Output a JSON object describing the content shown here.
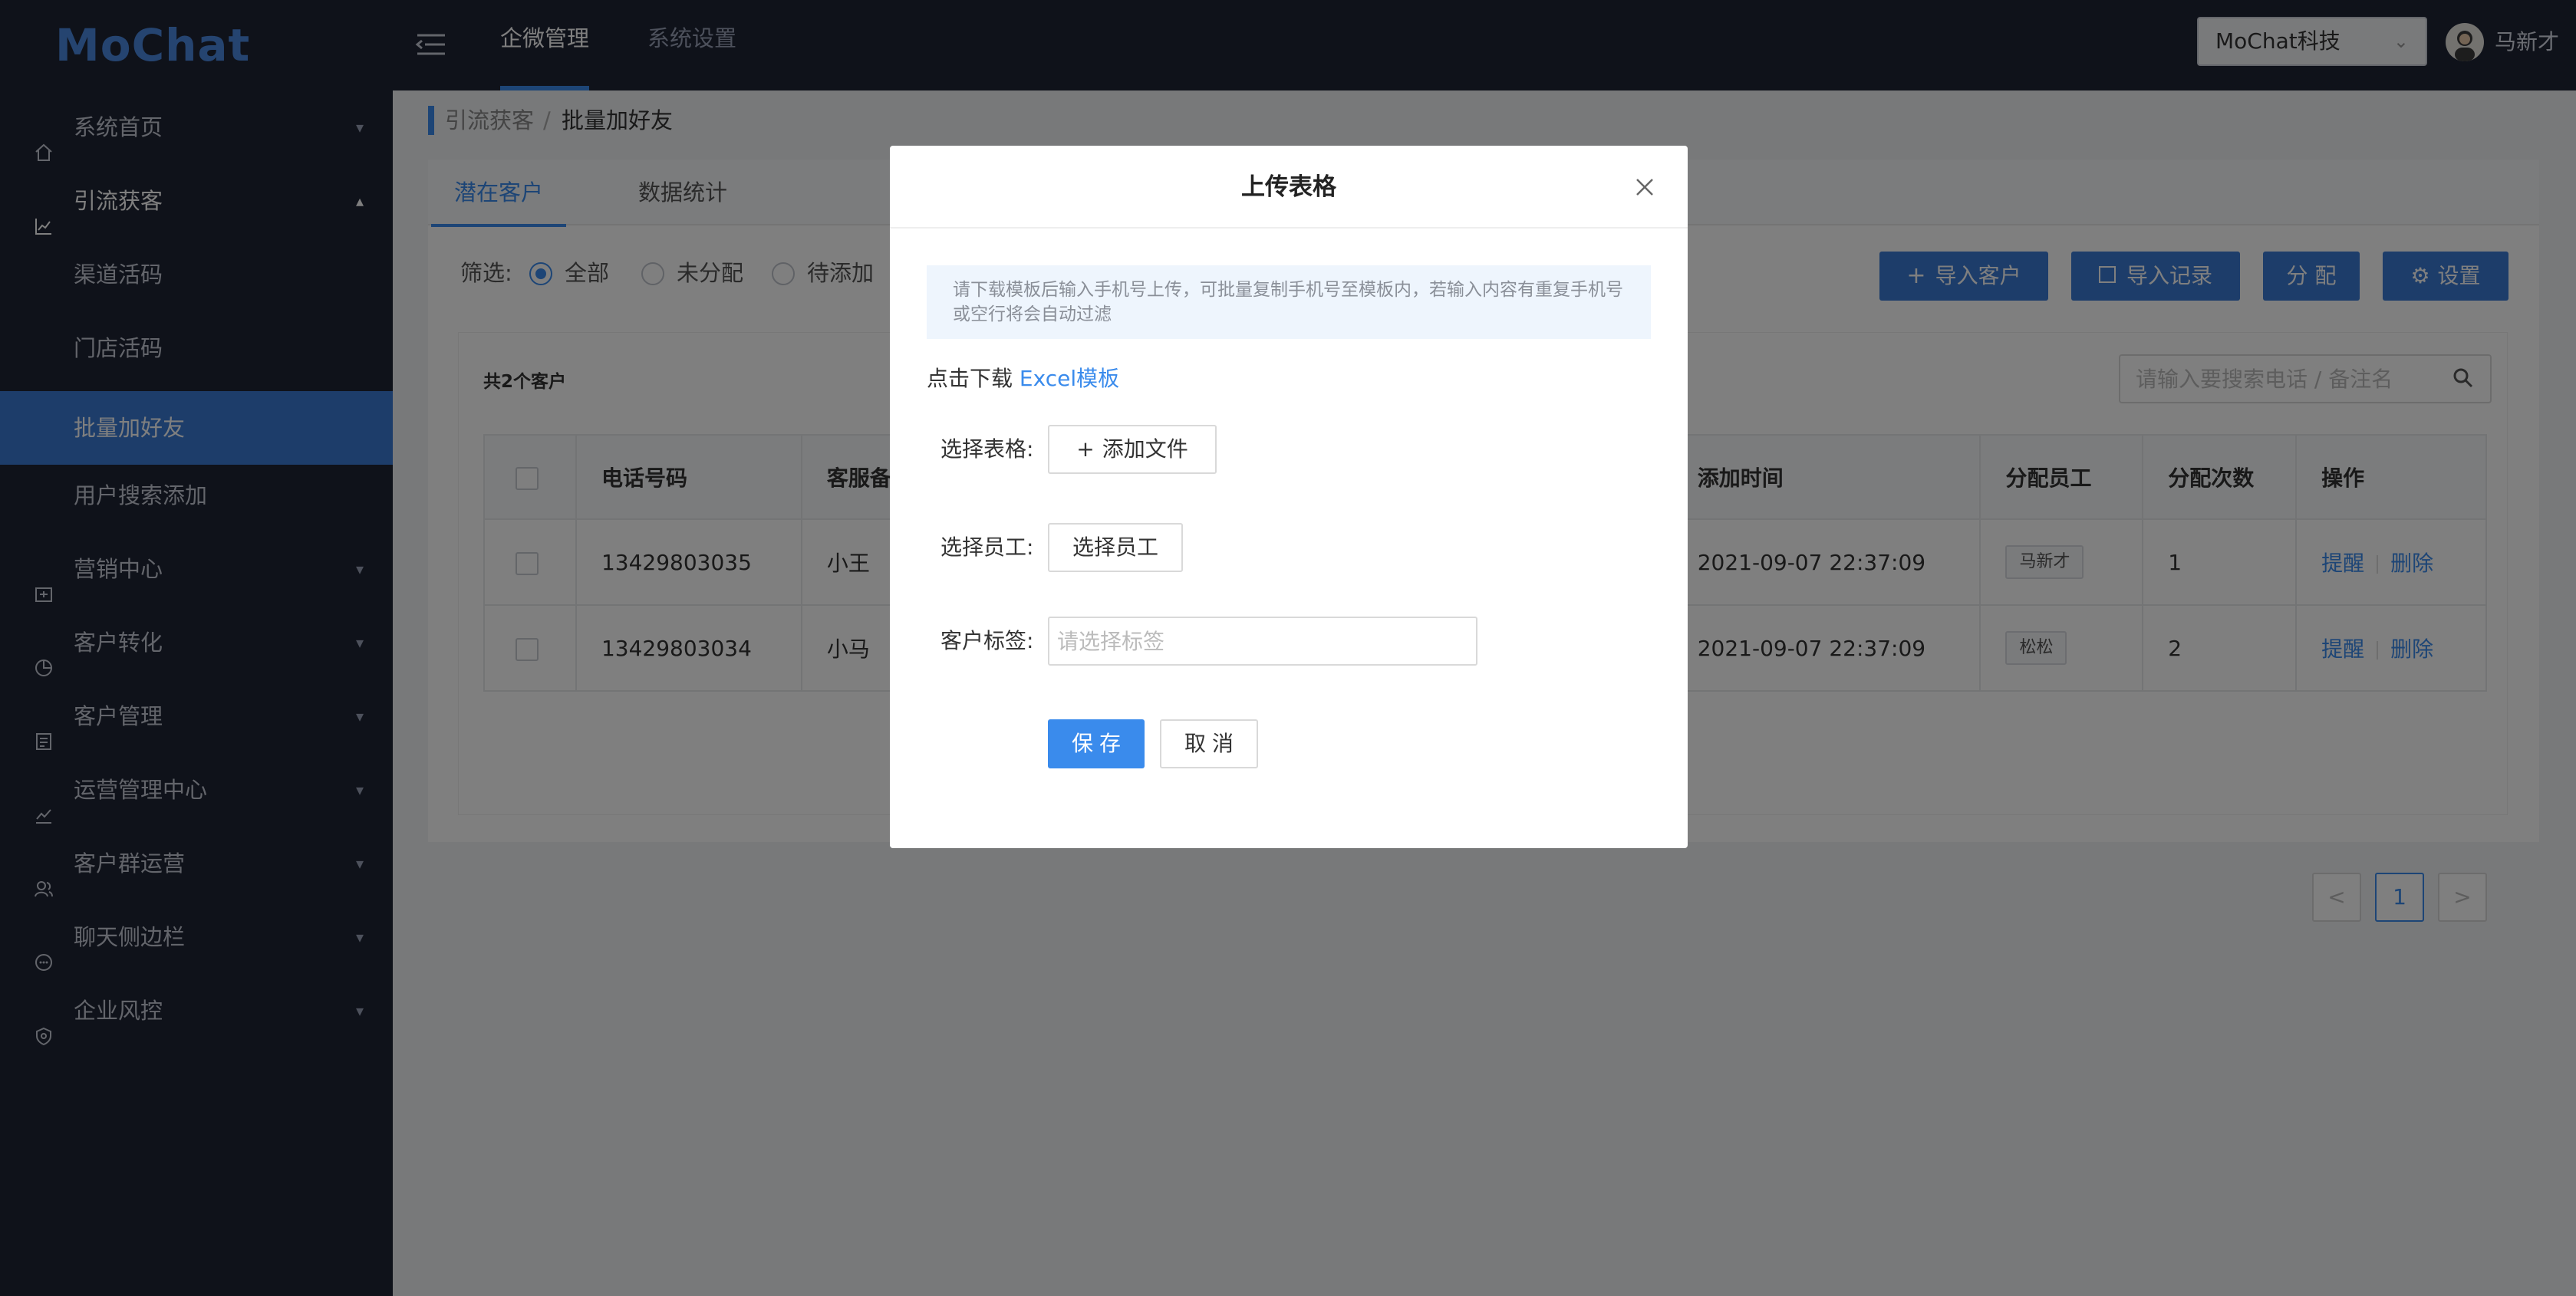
{
  "app": {
    "logo": "MoChat"
  },
  "top_nav": {
    "tabs": [
      {
        "label": "企微管理"
      },
      {
        "label": "系统设置"
      }
    ],
    "corp_select": "MoChat科技",
    "user_name": "马新才"
  },
  "sidebar": {
    "items": [
      {
        "label": "系统首页"
      },
      {
        "label": "引流获客"
      },
      {
        "label": "营销中心"
      },
      {
        "label": "客户转化"
      },
      {
        "label": "客户管理"
      },
      {
        "label": "运营管理中心"
      },
      {
        "label": "客户群运营"
      },
      {
        "label": "聊天侧边栏"
      },
      {
        "label": "企业风控"
      }
    ],
    "sub_items": [
      {
        "label": "渠道活码"
      },
      {
        "label": "门店活码"
      },
      {
        "label": "批量加好友"
      },
      {
        "label": "用户搜索添加"
      }
    ]
  },
  "breadcrumb": {
    "parent": "引流获客",
    "separator": "/",
    "current": "批量加好友"
  },
  "tabs": [
    {
      "label": "潜在客户"
    },
    {
      "label": "数据统计"
    }
  ],
  "filter": {
    "label": "筛选:",
    "options": [
      {
        "label": "全部"
      },
      {
        "label": "未分配"
      },
      {
        "label": "待添加"
      }
    ],
    "selected": "全部"
  },
  "actions": {
    "import_customer": "导入客户",
    "import_records": "导入记录",
    "assign": "分 配",
    "settings": "设置"
  },
  "search": {
    "placeholder": "请输入要搜索电话 / 备注名"
  },
  "list": {
    "count_text": "共2个客户",
    "columns": [
      "电话号码",
      "客服备",
      "添加时间",
      "分配员工",
      "分配次数",
      "操作"
    ],
    "rows": [
      {
        "phone": "13429803035",
        "remark": "小王",
        "time": "2021-09-07 22:37:09",
        "staff": "马新才",
        "times": "1",
        "remind": "提醒",
        "delete": "删除"
      },
      {
        "phone": "13429803034",
        "remark": "小马",
        "time": "2021-09-07 22:37:09",
        "staff": "松松",
        "times": "2",
        "remind": "提醒",
        "delete": "删除"
      }
    ]
  },
  "pagination": {
    "prev": "<",
    "current": "1",
    "next": ">"
  },
  "modal": {
    "title": "上传表格",
    "notice": "请下载模板后输入手机号上传，可批量复制手机号至模板内，若输入内容有重复手机号或空行将会自动过滤",
    "download_prefix": "点击下载",
    "download_link": "Excel模板",
    "file_label": "选择表格:",
    "add_file": "添加文件",
    "staff_label": "选择员工:",
    "select_staff": "选择员工",
    "tag_label": "客户标签:",
    "tag_placeholder": "请选择标签",
    "save": "保存",
    "cancel": "取消"
  },
  "colors": {
    "primary": "#3a8bec",
    "sidebar_bg": "#1f2435",
    "active_item": "#3a7bd5"
  }
}
